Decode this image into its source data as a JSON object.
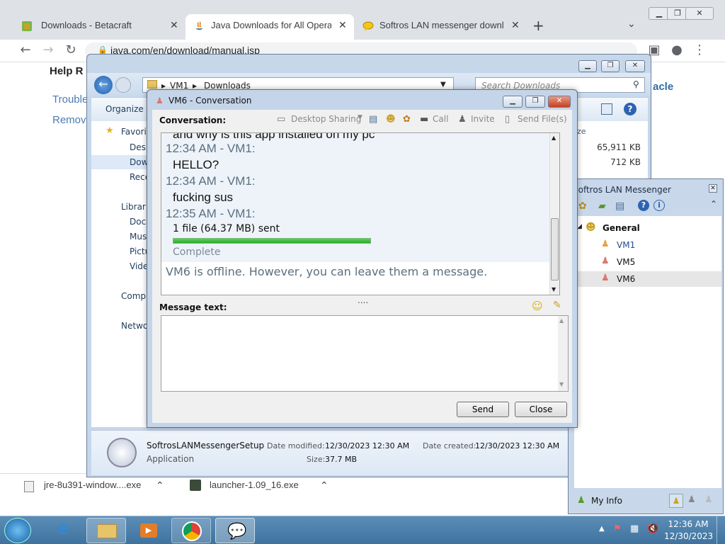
{
  "browser": {
    "tabs": [
      {
        "title": "Downloads - Betacraft",
        "active": false
      },
      {
        "title": "Java Downloads for All Operating",
        "active": true
      },
      {
        "title": "Softros LAN messenger downloa",
        "active": false
      }
    ],
    "url": "java.com/en/download/manual.jsp",
    "page_peek": {
      "help": "Help R",
      "trouble": "Trouble",
      "remove": "Remov",
      "brand": "acle"
    },
    "downloads": [
      {
        "name": "jre-8u391-window....exe"
      },
      {
        "name": "launcher-1.09_16.exe"
      }
    ]
  },
  "explorer": {
    "breadcrumb": [
      "VM1",
      "Downloads"
    ],
    "search_placeholder": "Search Downloads",
    "organize": "Organize",
    "nav_tree": [
      "Favorit",
      "Deskt",
      "Down",
      "Recen",
      "Librarie",
      "Docu",
      "Musi",
      "Pictu",
      "Video",
      "Compu",
      "Networ"
    ],
    "size_header": "ze",
    "sizes": [
      "65,911 KB",
      "712 KB"
    ],
    "details": {
      "name": "SoftrosLANMessengerSetup",
      "type": "Application",
      "date_modified_label": "Date modified:",
      "date_modified": "12/30/2023 12:30 AM",
      "date_created_label": "Date created:",
      "date_created": "12/30/2023 12:30 AM",
      "size_label": "Size:",
      "size": "37.7 MB"
    }
  },
  "messenger": {
    "title": "Softros LAN Messenger",
    "group": "General",
    "contacts": [
      {
        "name": "VM1",
        "status": "online"
      },
      {
        "name": "VM5",
        "status": "offline"
      },
      {
        "name": "VM6",
        "status": "offline",
        "selected": true
      }
    ],
    "my_info": "My Info"
  },
  "conversation": {
    "title": "VM6 - Conversation",
    "label": "Conversation:",
    "toolbar": {
      "desktop_sharing": "Desktop Sharing",
      "call": "Call",
      "invite": "Invite",
      "send_files": "Send File(s)"
    },
    "messages": [
      {
        "text": "and why is this app installed on my pc"
      },
      {
        "sender": "12:34 AM - VM1:",
        "text": "HELLO?"
      },
      {
        "sender": "12:34 AM - VM1:",
        "text": "fucking sus"
      },
      {
        "sender": "12:35 AM - VM1:"
      }
    ],
    "file_transfer": {
      "label": "1 file (64.37 MB) sent",
      "progress": 1.0,
      "status": "Complete"
    },
    "offline_notice": "VM6 is offline. However, you can leave them a message.",
    "message_label": "Message text:",
    "message_value": "",
    "send": "Send",
    "close": "Close"
  },
  "taskbar": {
    "time": "12:36 AM",
    "date": "12/30/2023"
  }
}
